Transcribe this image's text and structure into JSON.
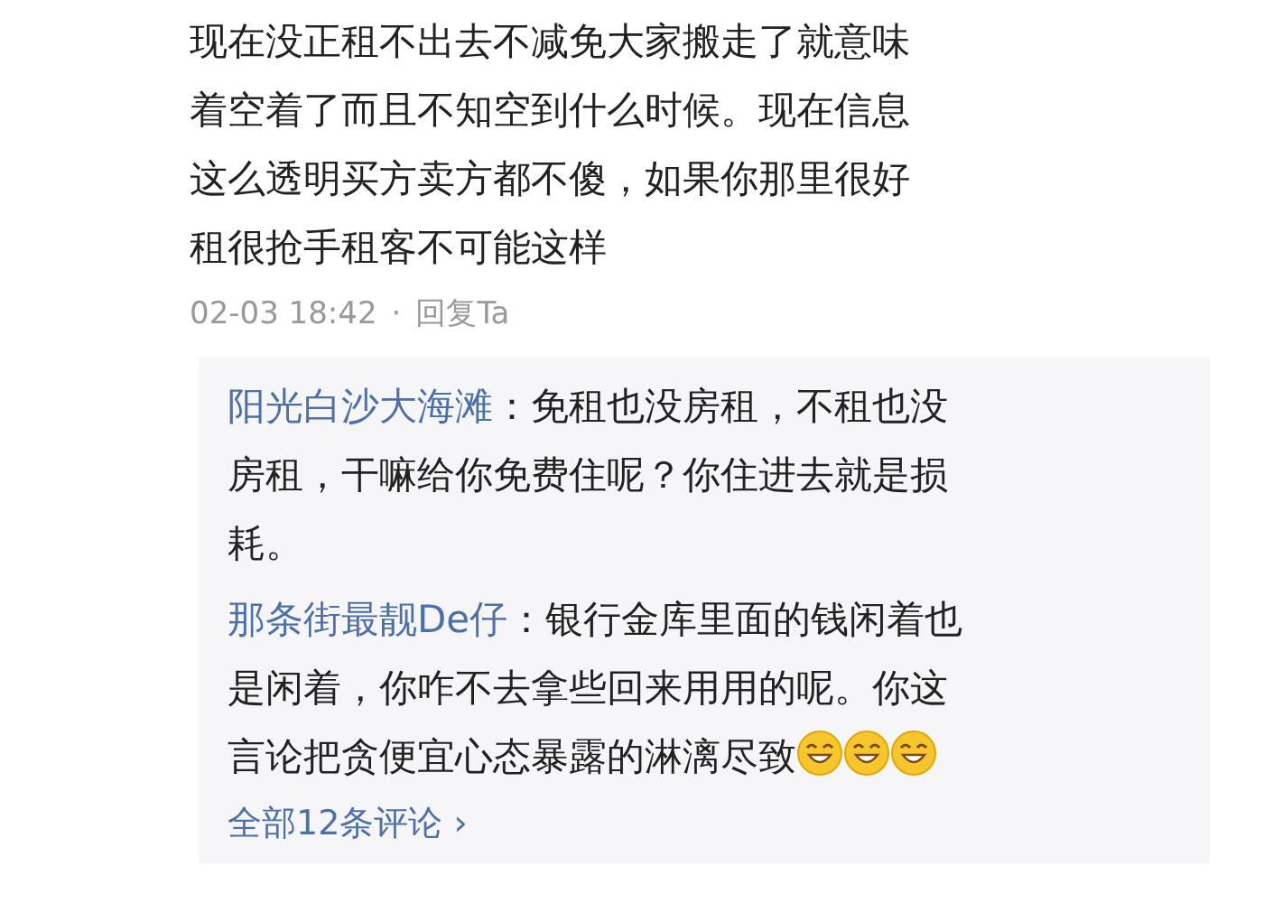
{
  "comment": {
    "text": "现在没正租不出去不减免大家搬走了就意味着空着了而且不知空到什么时候。现在信息这么透明买方卖方都不傻，如果你那里很好租很抢手租客不可能这样",
    "time": "02-03 18:42",
    "separator": "·",
    "reply_link": "回复Ta"
  },
  "replies": [
    {
      "author": "阳光白沙大海滩",
      "text": "：免租也没房租，不租也没房租，干嘛给你免费住呢？你住进去就是损耗。"
    },
    {
      "author": "那条街最靓De仔",
      "text": "：银行金库里面的钱闲着也是闲着，你咋不去拿些回来用用的呢。你这言论把贪便宜心态暴露的淋漓尽致",
      "emojis": [
        {
          "kind": "laugh"
        },
        {
          "kind": "laugh"
        },
        {
          "kind": "laugh"
        }
      ]
    }
  ],
  "all_comments_link": "全部12条评论 ›"
}
